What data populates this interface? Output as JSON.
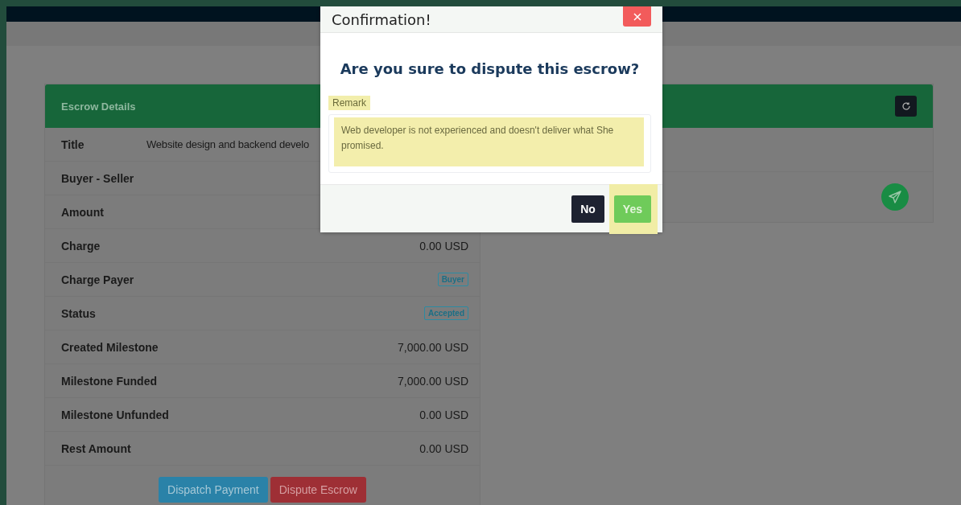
{
  "escrow_details": {
    "title": "Escrow Details",
    "rows": [
      {
        "label": "Title",
        "kind": "wide_text",
        "value": "Website design and backend develo"
      },
      {
        "label": "Buyer - Seller",
        "kind": "empty"
      },
      {
        "label": "Amount",
        "kind": "empty"
      },
      {
        "label": "Charge",
        "kind": "text",
        "value": "0.00 USD"
      },
      {
        "label": "Charge Payer",
        "kind": "badge",
        "value": "Buyer"
      },
      {
        "label": "Status",
        "kind": "badge",
        "value": "Accepted"
      },
      {
        "label": "Created Milestone",
        "kind": "text",
        "value": "7,000.00 USD"
      },
      {
        "label": "Milestone Funded",
        "kind": "text",
        "value": "7,000.00 USD"
      },
      {
        "label": "Milestone Unfunded",
        "kind": "text",
        "value": "0.00 USD"
      },
      {
        "label": "Rest Amount",
        "kind": "text",
        "value": "0.00 USD"
      }
    ],
    "actions": [
      {
        "label": "Dispatch Payment",
        "kind": "info"
      },
      {
        "label": "Dispute Escrow",
        "kind": "danger"
      }
    ]
  },
  "modal": {
    "title": "Confirmation!",
    "question": "Are you sure to dispute this escrow?",
    "remark_label": "Remark",
    "remark_label_highlighted": true,
    "remark": "Web developer is not experienced and doesn't deliver what She promised.",
    "remark_highlighted": true,
    "buttons": [
      {
        "label": "No",
        "kind": "dark",
        "highlighted": false
      },
      {
        "label": "Yes",
        "kind": "success",
        "highlighted": true
      }
    ]
  }
}
